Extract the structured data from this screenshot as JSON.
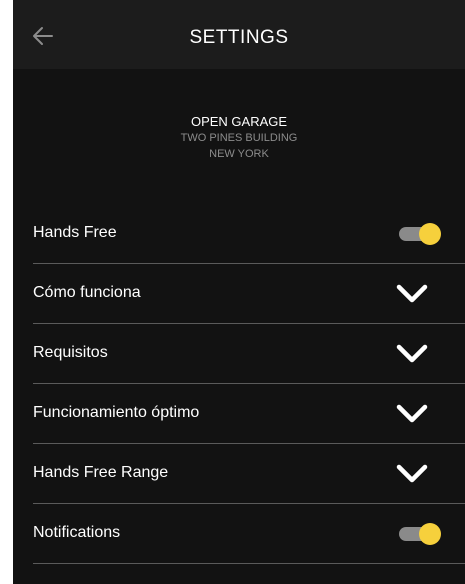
{
  "header": {
    "title": "SETTINGS",
    "back_icon": "arrow-left-icon"
  },
  "location": {
    "name": "OPEN GARAGE",
    "building": "TWO PINES BUILDING",
    "city": "NEW YORK"
  },
  "settings": [
    {
      "label": "Hands Free",
      "control": "toggle",
      "on": true
    },
    {
      "label": "Cómo funciona",
      "control": "chevron-down-icon"
    },
    {
      "label": "Requisitos",
      "control": "chevron-down-icon"
    },
    {
      "label": "Funcionamiento óptimo",
      "control": "chevron-down-icon"
    },
    {
      "label": "Hands Free Range",
      "control": "chevron-down-icon"
    },
    {
      "label": "Notifications",
      "control": "toggle",
      "on": true
    }
  ],
  "colors": {
    "background": "#121212",
    "header": "#1c1c1c",
    "toggle_knob": "#f6d03c",
    "toggle_track": "#8a8a8a",
    "divider": "#5a5a5a"
  }
}
